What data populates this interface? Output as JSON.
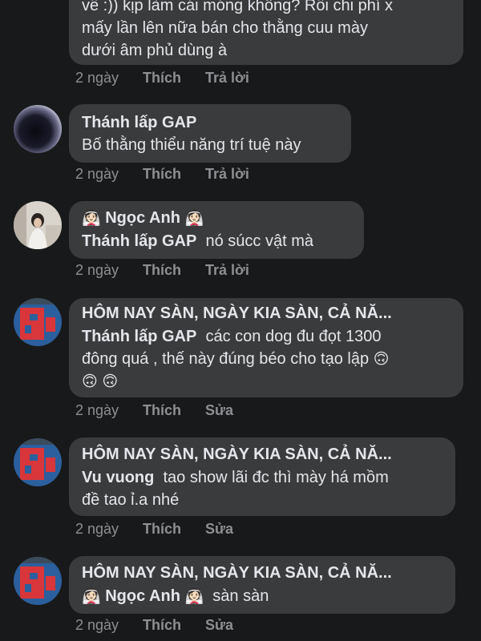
{
  "comments": [
    {
      "lines": [
        "về :)) kịp làm cái móng không?  Rồi chi phí x",
        "mấy lần lên nữa bán cho thằng cuu mày",
        "dưới âm phủ dùng à"
      ],
      "time": "2 ngày",
      "like": "Thích",
      "action": "Trả lời"
    },
    {
      "name": "Thánh lấp GAP",
      "lines": [
        "Bố thằng thiểu năng trí tuệ này"
      ],
      "time": "2 ngày",
      "like": "Thích",
      "action": "Trả lời",
      "avatar": "dark-sphere-avatar"
    },
    {
      "name": "Ngọc Anh",
      "name_emoji": "👰🏻",
      "mention": "Thánh lấp GAP",
      "text": "nó súcc vật mà",
      "time": "2 ngày",
      "like": "Thích",
      "action": "Trả lời",
      "avatar": "girl-photo-avatar"
    },
    {
      "name": "HÔM NAY SÀN, NGÀY KIA SÀN, CẢ NĂ...",
      "mention": "Thánh lấp GAP",
      "text": "các con dog đu đọt 1300",
      "lines": [
        "đông quá , thế này đúng béo cho tạo lập"
      ],
      "emoji": "🙃",
      "time": "2 ngày",
      "like": "Thích",
      "action": "Sửa",
      "avatar": "stock-board-avatar"
    },
    {
      "name": "HÔM NAY SÀN, NGÀY KIA SÀN, CẢ NĂ...",
      "mention": "Vu vuong",
      "text": "tao show lãi đc thì mày há mồm",
      "lines": [
        "đề tao ỉ.a nhé"
      ],
      "time": "2 ngày",
      "like": "Thích",
      "action": "Sửa",
      "avatar": "stock-board-avatar"
    },
    {
      "name": "HÔM NAY SÀN, NGÀY KIA SÀN, CẢ NĂ...",
      "mention": "Ngọc Anh",
      "mention_emoji": "👰🏻",
      "text": "sàn sàn",
      "time": "2 ngày",
      "like": "Thích",
      "action": "Sửa",
      "avatar": "stock-board-avatar"
    }
  ],
  "colors": {
    "background": "#18191a",
    "bubble": "#3a3b3c",
    "text": "#e4e6eb",
    "meta": "#8d8f93"
  }
}
